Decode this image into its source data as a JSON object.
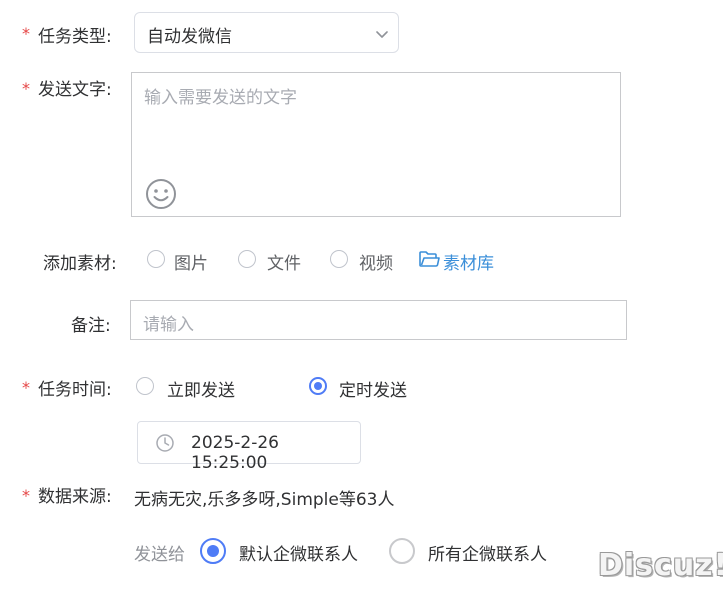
{
  "form": {
    "task_type": {
      "label": "任务类型:",
      "required_mark": "*",
      "value": "自动发微信",
      "icon": "chevron-down-icon"
    },
    "send_text": {
      "label": "发送文字:",
      "required_mark": "*",
      "placeholder": "输入需要发送的文字",
      "icon": "smiley-icon"
    },
    "materials": {
      "label": "添加素材:",
      "options": [
        "图片",
        "文件",
        "视频"
      ],
      "library_link": "素材库",
      "library_icon": "folder-icon"
    },
    "remark": {
      "label": "备注:",
      "placeholder": "请输入"
    },
    "task_time": {
      "label": "任务时间:",
      "required_mark": "*",
      "options": [
        "立即发送",
        "定时发送"
      ],
      "selected": "定时发送",
      "datetime": "2025-2-26 15:25:00",
      "icon": "clock-icon"
    },
    "data_source": {
      "label": "数据来源:",
      "required_mark": "*",
      "value": "无病无灾,乐多多呀,Simple等63人"
    },
    "send_to": {
      "label": "发送给",
      "options": [
        "默认企微联系人",
        "所有企微联系人"
      ],
      "selected": "默认企微联系人"
    }
  },
  "watermark": "Discuz!",
  "colors": {
    "accent": "#4f7cf6",
    "link": "#3b8fd9",
    "required": "#e54545"
  }
}
